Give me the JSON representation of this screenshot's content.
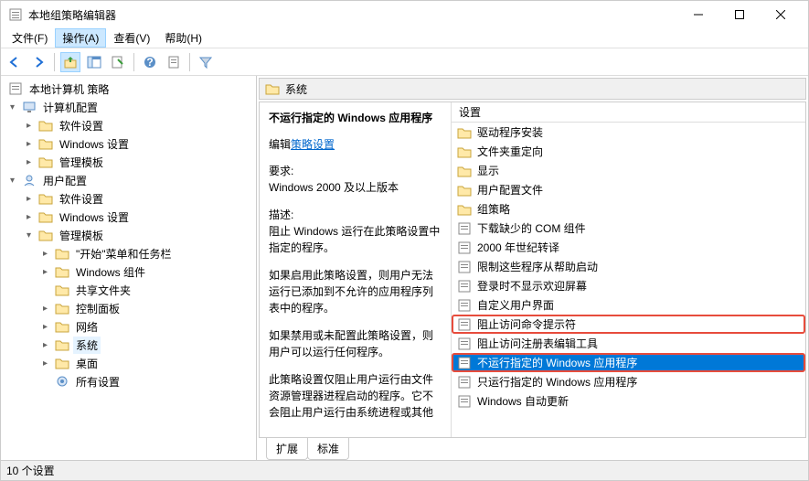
{
  "window": {
    "title": "本地组策略编辑器"
  },
  "menubar": {
    "file": "文件(F)",
    "action": "操作(A)",
    "view": "查看(V)",
    "help": "帮助(H)"
  },
  "tree": {
    "root": "本地计算机 策略",
    "computer": "计算机配置",
    "user": "用户配置",
    "software": "软件设置",
    "windows": "Windows 设置",
    "admin": "管理模板",
    "start_taskbar": "\"开始\"菜单和任务栏",
    "win_components": "Windows 组件",
    "shared_folders": "共享文件夹",
    "control_panel": "控制面板",
    "network": "网络",
    "system": "系统",
    "desktop": "桌面",
    "all_settings": "所有设置"
  },
  "right": {
    "header": "系统",
    "column_header": "设置",
    "desc": {
      "title": "不运行指定的 Windows 应用程序",
      "edit_prefix": "编辑",
      "edit_link": "策略设置",
      "req_label": "要求:",
      "req_text": "Windows 2000 及以上版本",
      "desc_label": "描述:",
      "desc_p1": "阻止 Windows 运行在此策略设置中指定的程序。",
      "desc_p2": "如果启用此策略设置，则用户无法运行已添加到不允许的应用程序列表中的程序。",
      "desc_p3": "如果禁用或未配置此策略设置，则用户可以运行任何程序。",
      "desc_p4": "此策略设置仅阻止用户运行由文件资源管理器进程启动的程序。它不会阻止用户运行由系统进程或其他"
    },
    "items": {
      "i0": "驱动程序安装",
      "i1": "文件夹重定向",
      "i2": "显示",
      "i3": "用户配置文件",
      "i4": "组策略",
      "i5": "下载缺少的 COM 组件",
      "i6": "2000 年世纪转译",
      "i7": "限制这些程序从帮助启动",
      "i8": "登录时不显示欢迎屏幕",
      "i9": "自定义用户界面",
      "i10": "阻止访问命令提示符",
      "i11": "阻止访问注册表编辑工具",
      "i12": "不运行指定的 Windows 应用程序",
      "i13": "只运行指定的 Windows 应用程序",
      "i14": "Windows 自动更新"
    }
  },
  "tabs": {
    "extended": "扩展",
    "standard": "标准"
  },
  "statusbar": {
    "text": "10 个设置"
  }
}
